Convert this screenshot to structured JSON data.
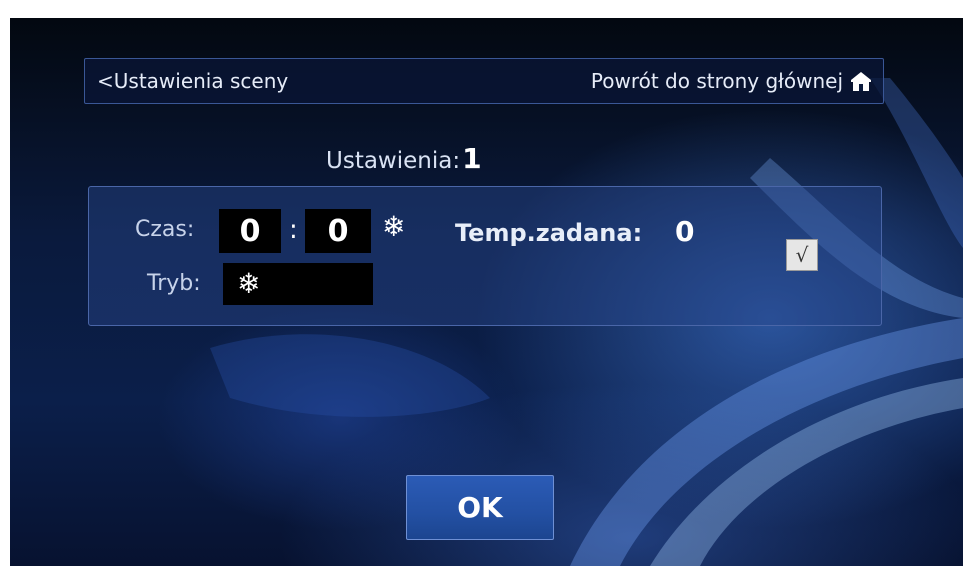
{
  "nav": {
    "back_label": "<Ustawienia sceny",
    "home_label": "Powrót do strony głównej"
  },
  "settings": {
    "label": "Ustawienia:",
    "number": "1"
  },
  "panel": {
    "time_label": "Czas:",
    "hours": "0",
    "colon": ":",
    "minutes": "0",
    "mode_label": "Tryb:",
    "target_temp_label": "Temp.zadana:",
    "target_temp_value": "0",
    "checkbox_mark": "√",
    "mode_icon": "snowflake-icon",
    "indicator_icon": "snowflake-icon"
  },
  "ok_label": "OK",
  "colors": {
    "accent": "#2b5bb6",
    "panel_border": "#4a66a8",
    "field_bg": "#000000"
  }
}
